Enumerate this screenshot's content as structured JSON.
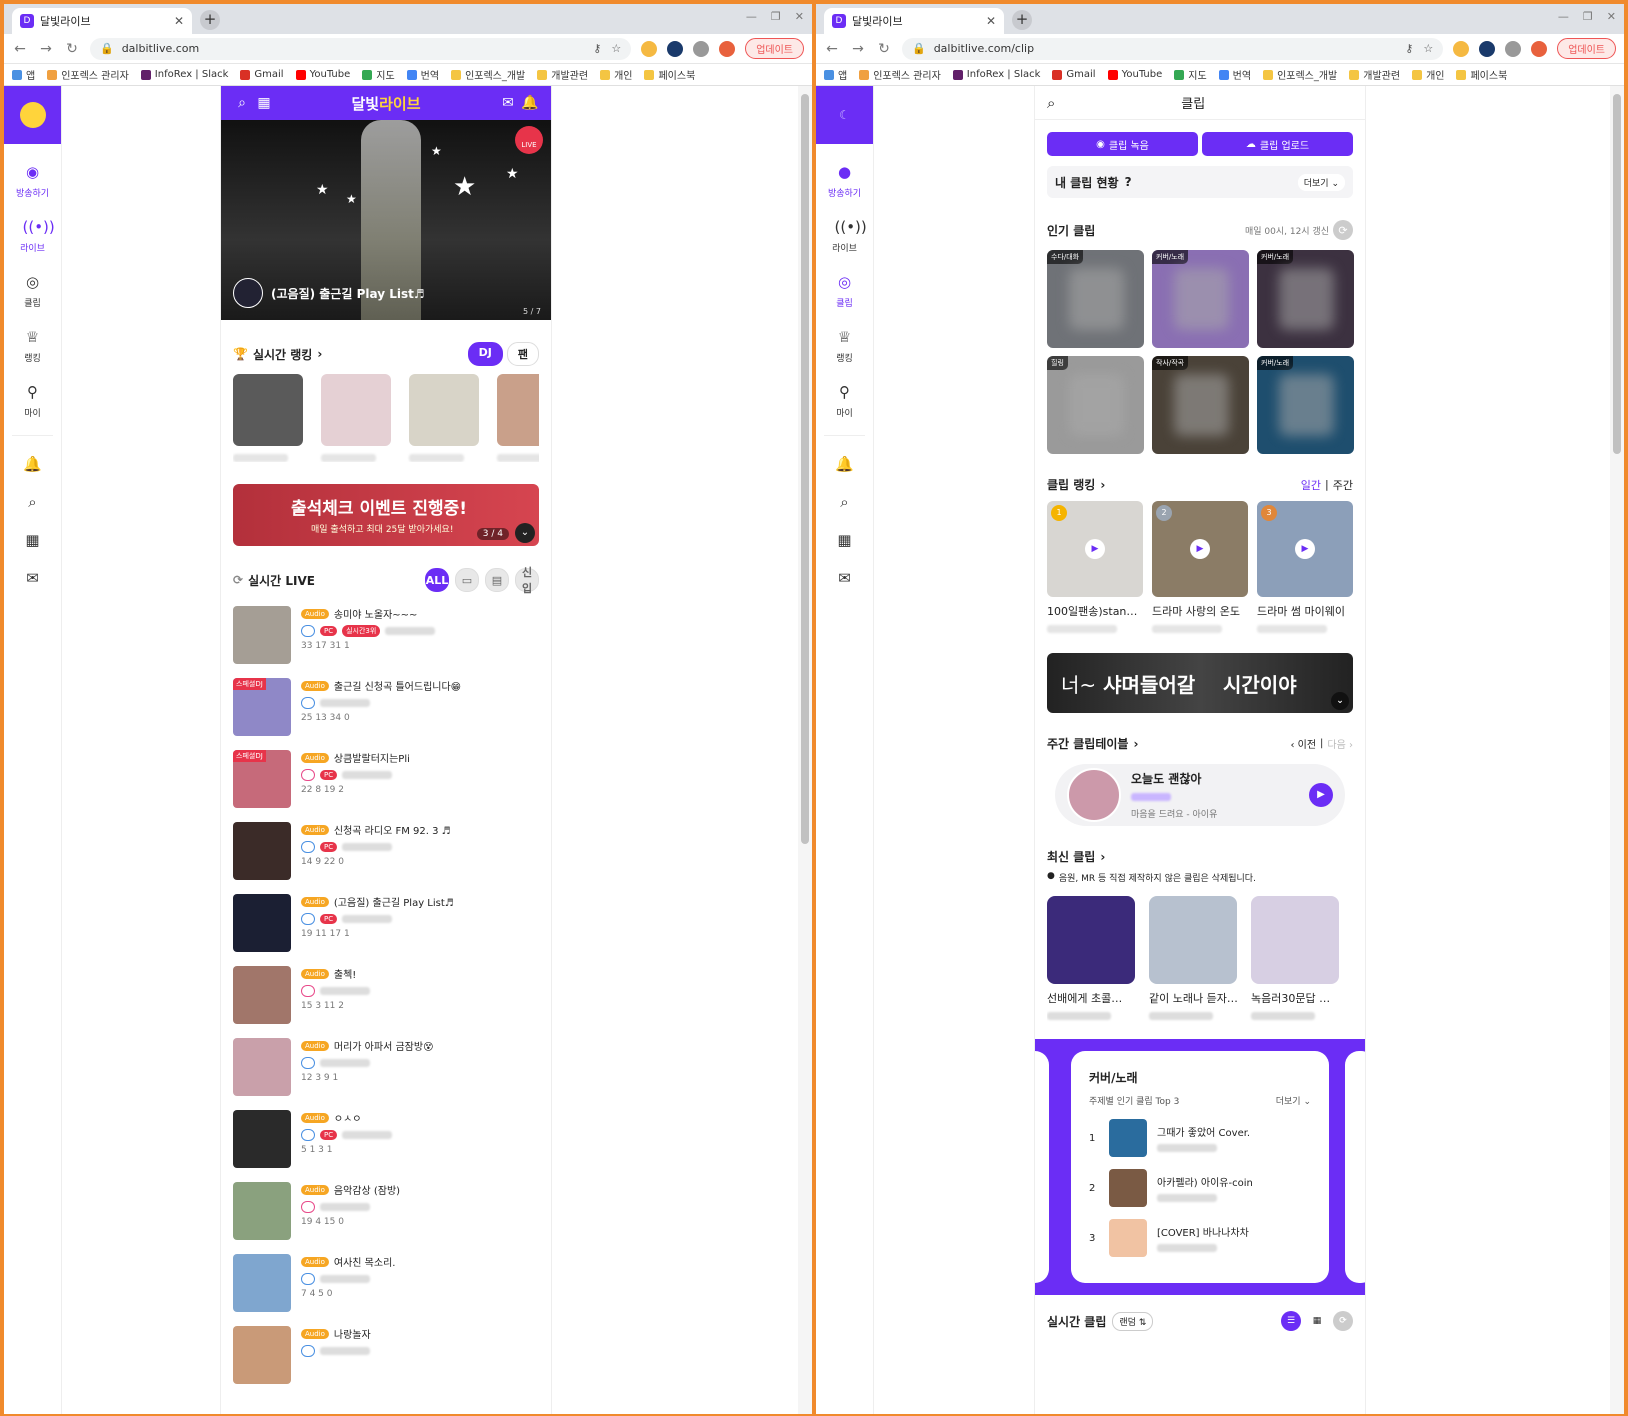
{
  "browser_left": {
    "tab_title": "달빛라이브",
    "url": "dalbitlive.com",
    "update_label": "업데이트"
  },
  "browser_right": {
    "tab_title": "달빛라이브",
    "url": "dalbitlive.com/clip",
    "update_label": "업데이트"
  },
  "bookmarks": [
    "앱",
    "인포렉스 관리자",
    "InfoRex | Slack",
    "Gmail",
    "YouTube",
    "지도",
    "번역",
    "인포렉스_개발",
    "개발관련",
    "개인",
    "페이스북"
  ],
  "sidebar": {
    "items": [
      {
        "label": "방송하기",
        "icon": "broadcast-icon"
      },
      {
        "label": "라이브",
        "icon": "live-radio-icon"
      },
      {
        "label": "클립",
        "icon": "clip-disc-icon"
      },
      {
        "label": "랭킹",
        "icon": "trophy-icon"
      },
      {
        "label": "마이",
        "icon": "person-icon"
      }
    ]
  },
  "main": {
    "brand_a": "달빛",
    "brand_b": "라이브",
    "hero": {
      "title": "(고음질) 출근길 Play List♬",
      "live_badge": "LIVE",
      "page": "5 / 7"
    },
    "ranking": {
      "title": "실시간 랭킹",
      "tab_dj": "DJ",
      "tab_fan": "팬"
    },
    "banner": {
      "title": "출석체크 이벤트 진행중!",
      "subtitle": "매일 출석하고 최대 25달 받아가세요!",
      "page": "3 / 4"
    },
    "live_section": {
      "title": "실시간 LIVE",
      "filter_all": "ALL",
      "filter_new": "신입"
    },
    "live_items": [
      {
        "title": "송미야 노올자~~~",
        "tag": "Audio",
        "pc": "PC",
        "rank": "실시간3위",
        "stats": "33  17  31  1",
        "special": "",
        "thumb": "#a59e95"
      },
      {
        "title": "출근길 신청곡 틀어드립니다😁",
        "tag": "Audio",
        "pc": "",
        "rank": "",
        "stats": "25  13  34  0",
        "special": "스페셜DJ",
        "thumb": "#8f88c7"
      },
      {
        "title": "상큼발랄터지는Pli",
        "tag": "Audio",
        "pc": "PC",
        "rank": "",
        "stats": "22  8  19  2",
        "special": "스페셜DJ",
        "thumb": "#c66a7a"
      },
      {
        "title": "신청곡 라디오 FM 92. 3 ♬",
        "tag": "Audio",
        "pc": "PC",
        "rank": "",
        "stats": "14  9  22  0",
        "special": "",
        "thumb": "#3b2b28"
      },
      {
        "title": "(고음질) 출근길 Play List♬",
        "tag": "Audio",
        "pc": "PC",
        "rank": "",
        "stats": "19  11  17  1",
        "special": "",
        "thumb": "#1b1f33"
      },
      {
        "title": "출첵!",
        "tag": "Audio",
        "pc": "",
        "rank": "",
        "stats": "15  3  11  2",
        "special": "",
        "thumb": "#a1766a"
      },
      {
        "title": "머리가 아파서 금잠방😵",
        "tag": "Audio",
        "pc": "",
        "rank": "",
        "stats": "12  3  9  1",
        "special": "",
        "thumb": "#c9a0aa"
      },
      {
        "title": "ㅇㅅㅇ",
        "tag": "Audio",
        "pc": "PC",
        "rank": "",
        "stats": "5  1  3  1",
        "special": "",
        "thumb": "#2a2a2a"
      },
      {
        "title": "음악감상 (잠방)",
        "tag": "Audio",
        "pc": "",
        "rank": "",
        "stats": "19  4  15  0",
        "special": "",
        "thumb": "#8aa17e"
      },
      {
        "title": "여사친 목소리.",
        "tag": "Audio",
        "pc": "",
        "rank": "",
        "stats": "7  4  5  0",
        "special": "",
        "thumb": "#7fa6cf"
      },
      {
        "title": "나랑놀자",
        "tag": "Audio",
        "pc": "",
        "rank": "",
        "stats": "",
        "special": "",
        "thumb": "#c99a78"
      }
    ]
  },
  "clip": {
    "title": "클립",
    "record_btn": "클립 녹음",
    "upload_btn": "클립 업로드",
    "my_status": "내 클립 현황",
    "help": "?",
    "more": "더보기",
    "popular": {
      "title": "인기 클립",
      "note": "매일 00시, 12시 갱신",
      "items": [
        {
          "label": "수다/대화",
          "color": "#6f7277"
        },
        {
          "label": "커버/노래",
          "color": "#8a6fb3"
        },
        {
          "label": "커버/노래",
          "color": "#3c3140"
        },
        {
          "label": "힐링",
          "color": "#9a9a9a"
        },
        {
          "label": "작사/작곡",
          "color": "#4a4238"
        },
        {
          "label": "커버/노래",
          "color": "#1e4e6e"
        }
      ]
    },
    "ranking": {
      "title": "클립 랭킹",
      "daily": "일간",
      "weekly": "주간",
      "items": [
        {
          "title": "100일팬송)stan…",
          "medal": "1",
          "medal_color": "#f5b400",
          "color": "#d8d6d2"
        },
        {
          "title": "드라마 사랑의 온도",
          "medal": "2",
          "medal_color": "#9aa4b0",
          "color": "#8b7c66"
        },
        {
          "title": "드라마 썸 마이웨이",
          "medal": "3",
          "medal_color": "#e0873a",
          "color": "#8c9fb9"
        }
      ]
    },
    "band": {
      "pre": "너~",
      "bold": "샤며들어갈",
      "post": "시간이야"
    },
    "table": {
      "title": "주간 클립테이블",
      "prev": "이전",
      "next": "다음",
      "song": "오늘도 괜찮아",
      "artist": "마음을 드려요 - 아이유"
    },
    "recent": {
      "title": "최신 클립",
      "notice": "음원, MR 등 직접 제작하지 않은 클립은 삭제됩니다.",
      "items": [
        {
          "title": "선배에게 초콜…",
          "color": "#3b2a7a"
        },
        {
          "title": "같이 노래나 듣자…",
          "color": "#b7c1cf"
        },
        {
          "title": "녹음러30문답 …",
          "color": "#d7cfe3"
        }
      ]
    },
    "top3": {
      "title": "커버/노래",
      "subtitle": "주제별 인기 클립 Top 3",
      "more": "더보기",
      "items": [
        {
          "rank": "1",
          "title": "그때가 좋았어 Cover.",
          "color": "#2a6c9e"
        },
        {
          "rank": "2",
          "title": "아카펠라) 아이유-coin",
          "color": "#7a5a44"
        },
        {
          "rank": "3",
          "title": "[COVER] 바나나차차",
          "color": "#f1c3a3"
        }
      ]
    },
    "realtime": {
      "title": "실시간 클립",
      "random": "랜덤"
    }
  },
  "colors": {
    "brand": "#6b2df5",
    "accent_yellow": "#ffd43b",
    "live_red": "#e7344a",
    "audio_tag": "#f6a623",
    "frame": "#f08a2c"
  }
}
